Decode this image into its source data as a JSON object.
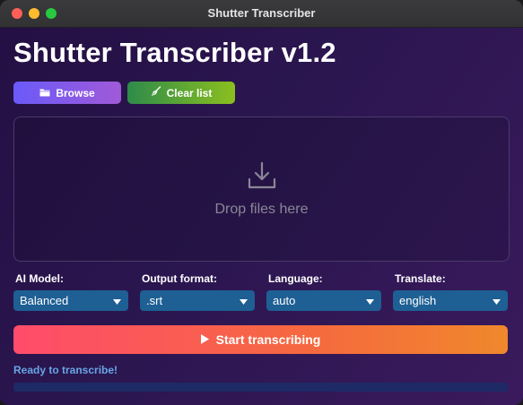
{
  "window": {
    "title": "Shutter Transcriber",
    "controls": [
      "close",
      "minimize",
      "maximize"
    ]
  },
  "app": {
    "heading": "Shutter Transcriber v1.2"
  },
  "toolbar": {
    "browse_label": "Browse",
    "browse_icon": "folder-icon",
    "clear_label": "Clear list",
    "clear_icon": "broom-icon"
  },
  "dropzone": {
    "icon": "download-icon",
    "text": "Drop files here"
  },
  "options": [
    {
      "label": "AI Model:",
      "value": "Balanced"
    },
    {
      "label": "Output format:",
      "value": ".srt"
    },
    {
      "label": "Language:",
      "value": "auto"
    },
    {
      "label": "Translate:",
      "value": "english"
    }
  ],
  "start": {
    "label": "Start transcribing",
    "icon": "play-icon"
  },
  "status": {
    "text": "Ready to transcribe!",
    "progress_fraction": 0
  },
  "colors": {
    "browse_gradient": [
      "#6a5af9",
      "#a05ad8"
    ],
    "clear_gradient": [
      "#2e8b4a",
      "#8bbf1f"
    ],
    "start_gradient": [
      "#ff4c6b",
      "#f0882c"
    ],
    "select_bg": "#1e5f94",
    "status_text": "#68a6e6",
    "progress_track": "#1e2a66"
  }
}
